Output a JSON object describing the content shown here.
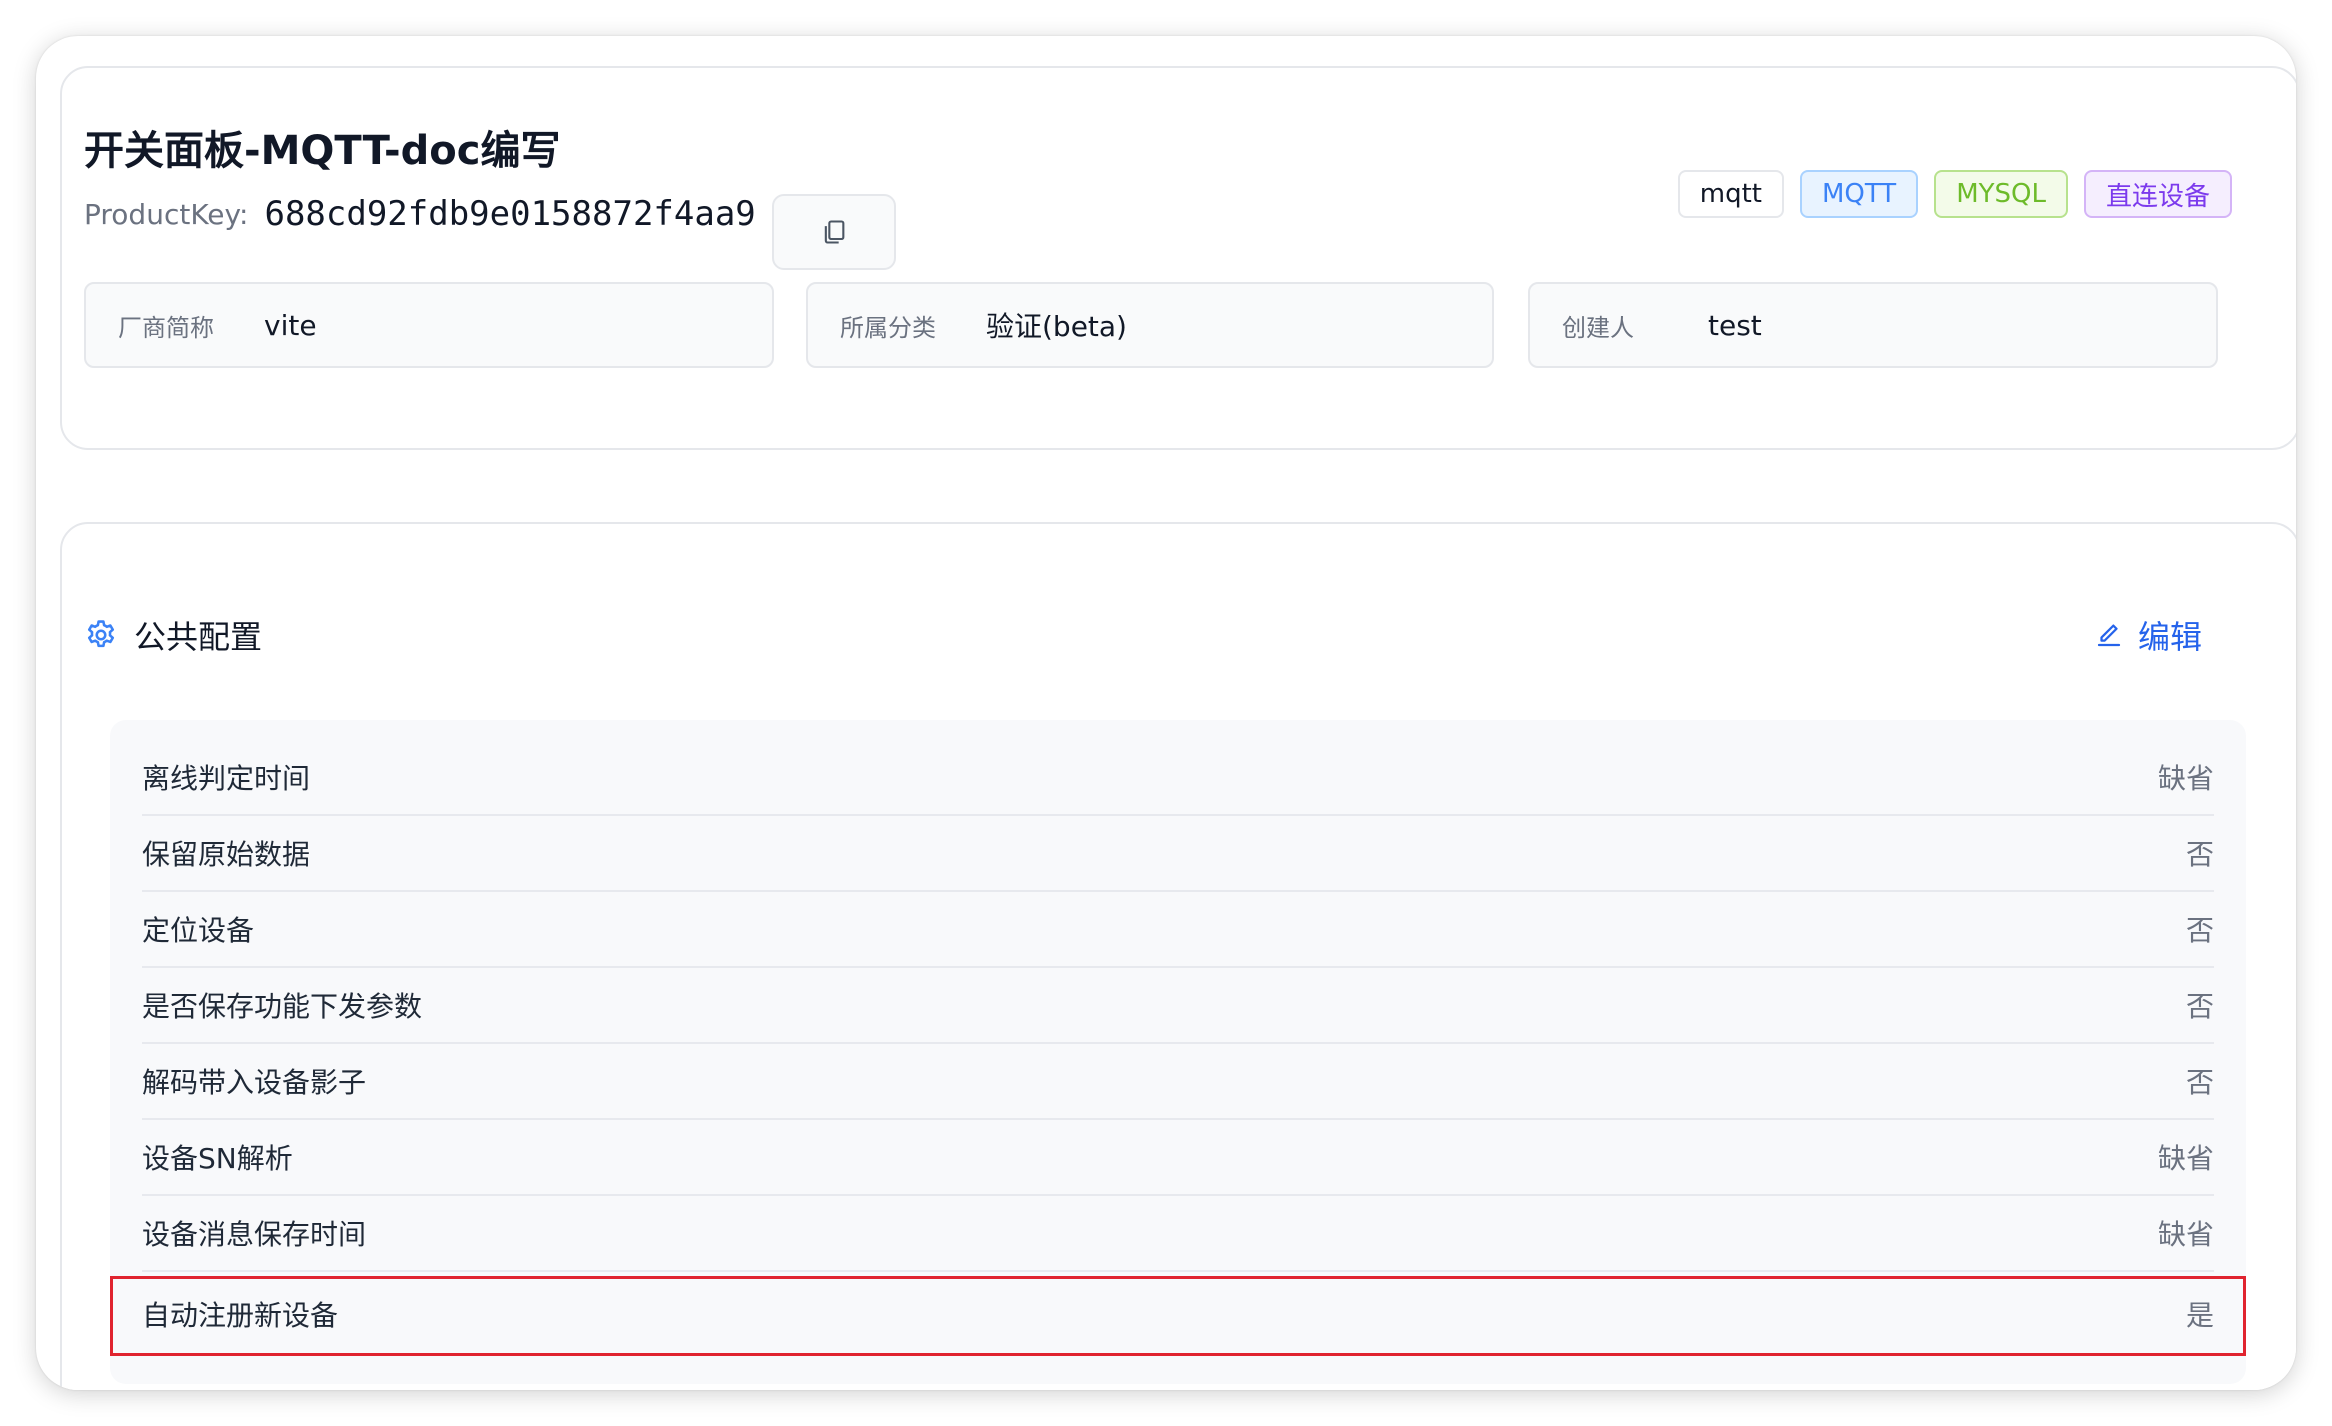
{
  "product": {
    "title": "开关面板-MQTT-doc编写",
    "product_key_label": "ProductKey:",
    "product_key": "688cd92fdb9e0158872f4aa9",
    "tags": [
      "mqtt",
      "MQTT",
      "MYSQL",
      "直连设备"
    ]
  },
  "info": [
    {
      "label": "厂商简称",
      "value": "vite"
    },
    {
      "label": "所属分类",
      "value": "验证(beta)"
    },
    {
      "label": "创建人",
      "value": "test"
    }
  ],
  "config": {
    "title": "公共配置",
    "edit_label": "编辑",
    "rows": [
      {
        "key": "离线判定时间",
        "value": "缺省"
      },
      {
        "key": "保留原始数据",
        "value": "否"
      },
      {
        "key": "定位设备",
        "value": "否"
      },
      {
        "key": "是否保存功能下发参数",
        "value": "否"
      },
      {
        "key": "解码带入设备影子",
        "value": "否"
      },
      {
        "key": "设备SN解析",
        "value": "缺省"
      },
      {
        "key": "设备消息保存时间",
        "value": "缺省"
      },
      {
        "key": "自动注册新设备",
        "value": "是"
      }
    ]
  },
  "icons": {
    "copy": "copy-icon",
    "settings": "gear-icon",
    "edit": "pencil-icon"
  },
  "colors": {
    "accent": "#2563eb",
    "highlight_border": "#e0242f"
  }
}
